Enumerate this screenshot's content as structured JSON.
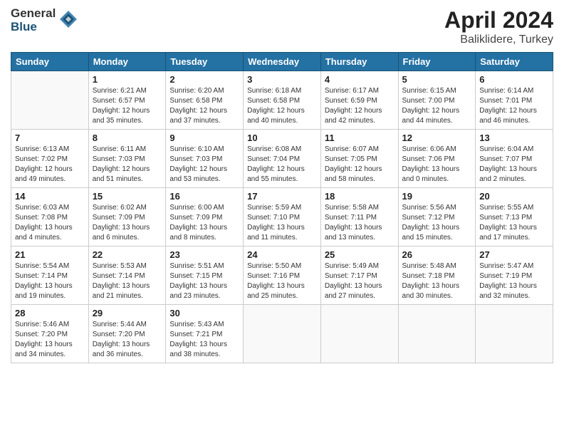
{
  "logo": {
    "general": "General",
    "blue": "Blue"
  },
  "title": "April 2024",
  "subtitle": "Baliklidere, Turkey",
  "headers": [
    "Sunday",
    "Monday",
    "Tuesday",
    "Wednesday",
    "Thursday",
    "Friday",
    "Saturday"
  ],
  "weeks": [
    [
      {
        "day": "",
        "info": ""
      },
      {
        "day": "1",
        "info": "Sunrise: 6:21 AM\nSunset: 6:57 PM\nDaylight: 12 hours\nand 35 minutes."
      },
      {
        "day": "2",
        "info": "Sunrise: 6:20 AM\nSunset: 6:58 PM\nDaylight: 12 hours\nand 37 minutes."
      },
      {
        "day": "3",
        "info": "Sunrise: 6:18 AM\nSunset: 6:58 PM\nDaylight: 12 hours\nand 40 minutes."
      },
      {
        "day": "4",
        "info": "Sunrise: 6:17 AM\nSunset: 6:59 PM\nDaylight: 12 hours\nand 42 minutes."
      },
      {
        "day": "5",
        "info": "Sunrise: 6:15 AM\nSunset: 7:00 PM\nDaylight: 12 hours\nand 44 minutes."
      },
      {
        "day": "6",
        "info": "Sunrise: 6:14 AM\nSunset: 7:01 PM\nDaylight: 12 hours\nand 46 minutes."
      }
    ],
    [
      {
        "day": "7",
        "info": "Sunrise: 6:13 AM\nSunset: 7:02 PM\nDaylight: 12 hours\nand 49 minutes."
      },
      {
        "day": "8",
        "info": "Sunrise: 6:11 AM\nSunset: 7:03 PM\nDaylight: 12 hours\nand 51 minutes."
      },
      {
        "day": "9",
        "info": "Sunrise: 6:10 AM\nSunset: 7:03 PM\nDaylight: 12 hours\nand 53 minutes."
      },
      {
        "day": "10",
        "info": "Sunrise: 6:08 AM\nSunset: 7:04 PM\nDaylight: 12 hours\nand 55 minutes."
      },
      {
        "day": "11",
        "info": "Sunrise: 6:07 AM\nSunset: 7:05 PM\nDaylight: 12 hours\nand 58 minutes."
      },
      {
        "day": "12",
        "info": "Sunrise: 6:06 AM\nSunset: 7:06 PM\nDaylight: 13 hours\nand 0 minutes."
      },
      {
        "day": "13",
        "info": "Sunrise: 6:04 AM\nSunset: 7:07 PM\nDaylight: 13 hours\nand 2 minutes."
      }
    ],
    [
      {
        "day": "14",
        "info": "Sunrise: 6:03 AM\nSunset: 7:08 PM\nDaylight: 13 hours\nand 4 minutes."
      },
      {
        "day": "15",
        "info": "Sunrise: 6:02 AM\nSunset: 7:09 PM\nDaylight: 13 hours\nand 6 minutes."
      },
      {
        "day": "16",
        "info": "Sunrise: 6:00 AM\nSunset: 7:09 PM\nDaylight: 13 hours\nand 8 minutes."
      },
      {
        "day": "17",
        "info": "Sunrise: 5:59 AM\nSunset: 7:10 PM\nDaylight: 13 hours\nand 11 minutes."
      },
      {
        "day": "18",
        "info": "Sunrise: 5:58 AM\nSunset: 7:11 PM\nDaylight: 13 hours\nand 13 minutes."
      },
      {
        "day": "19",
        "info": "Sunrise: 5:56 AM\nSunset: 7:12 PM\nDaylight: 13 hours\nand 15 minutes."
      },
      {
        "day": "20",
        "info": "Sunrise: 5:55 AM\nSunset: 7:13 PM\nDaylight: 13 hours\nand 17 minutes."
      }
    ],
    [
      {
        "day": "21",
        "info": "Sunrise: 5:54 AM\nSunset: 7:14 PM\nDaylight: 13 hours\nand 19 minutes."
      },
      {
        "day": "22",
        "info": "Sunrise: 5:53 AM\nSunset: 7:14 PM\nDaylight: 13 hours\nand 21 minutes."
      },
      {
        "day": "23",
        "info": "Sunrise: 5:51 AM\nSunset: 7:15 PM\nDaylight: 13 hours\nand 23 minutes."
      },
      {
        "day": "24",
        "info": "Sunrise: 5:50 AM\nSunset: 7:16 PM\nDaylight: 13 hours\nand 25 minutes."
      },
      {
        "day": "25",
        "info": "Sunrise: 5:49 AM\nSunset: 7:17 PM\nDaylight: 13 hours\nand 27 minutes."
      },
      {
        "day": "26",
        "info": "Sunrise: 5:48 AM\nSunset: 7:18 PM\nDaylight: 13 hours\nand 30 minutes."
      },
      {
        "day": "27",
        "info": "Sunrise: 5:47 AM\nSunset: 7:19 PM\nDaylight: 13 hours\nand 32 minutes."
      }
    ],
    [
      {
        "day": "28",
        "info": "Sunrise: 5:46 AM\nSunset: 7:20 PM\nDaylight: 13 hours\nand 34 minutes."
      },
      {
        "day": "29",
        "info": "Sunrise: 5:44 AM\nSunset: 7:20 PM\nDaylight: 13 hours\nand 36 minutes."
      },
      {
        "day": "30",
        "info": "Sunrise: 5:43 AM\nSunset: 7:21 PM\nDaylight: 13 hours\nand 38 minutes."
      },
      {
        "day": "",
        "info": ""
      },
      {
        "day": "",
        "info": ""
      },
      {
        "day": "",
        "info": ""
      },
      {
        "day": "",
        "info": ""
      }
    ]
  ]
}
